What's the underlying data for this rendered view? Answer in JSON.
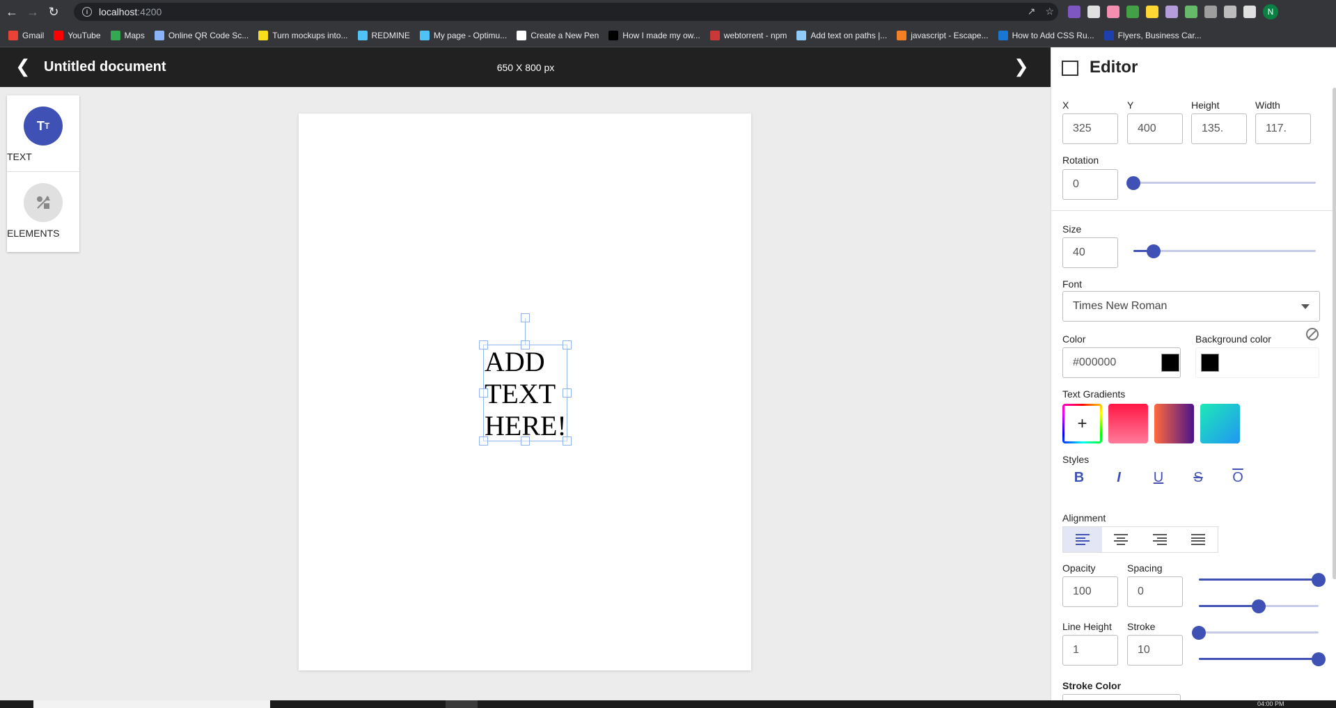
{
  "browser": {
    "url_host": "localhost",
    "url_port": ":4200",
    "bookmarks": [
      {
        "label": "Gmail",
        "color": "#ea4335"
      },
      {
        "label": "YouTube",
        "color": "#ff0000"
      },
      {
        "label": "Maps",
        "color": "#34a853"
      },
      {
        "label": "Online QR Code Sc...",
        "color": "#8ab4f8"
      },
      {
        "label": "Turn mockups into...",
        "color": "#f7df1e"
      },
      {
        "label": "REDMINE",
        "color": "#4fc3f7"
      },
      {
        "label": "My page - Optimu...",
        "color": "#4fc3f7"
      },
      {
        "label": "Create a New Pen",
        "color": "#ffffff"
      },
      {
        "label": "How I made my ow...",
        "color": "#000000"
      },
      {
        "label": "webtorrent - npm",
        "color": "#cb3837"
      },
      {
        "label": "Add text on paths |...",
        "color": "#90caf9"
      },
      {
        "label": "javascript - Escape...",
        "color": "#f48024"
      },
      {
        "label": "How to Add CSS Ru...",
        "color": "#1976d2"
      },
      {
        "label": "Flyers, Business Car...",
        "color": "#1e40af"
      }
    ],
    "profile_initial": "N"
  },
  "header": {
    "title": "Untitled document",
    "canvas_size": "650 X 800 px"
  },
  "tools": [
    {
      "label": "TEXT",
      "icon": "text-icon"
    },
    {
      "label": "ELEMENTS",
      "icon": "shapes-icon"
    }
  ],
  "canvas": {
    "text_lines": [
      "ADD",
      "TEXT",
      "HERE!"
    ]
  },
  "editor": {
    "title": "Editor",
    "x_label": "X",
    "x_value": "325",
    "y_label": "Y",
    "y_value": "400",
    "height_label": "Height",
    "height_value": "135.",
    "width_label": "Width",
    "width_value": "117.",
    "rotation_label": "Rotation",
    "rotation_value": "0",
    "size_label": "Size",
    "size_value": "40",
    "font_label": "Font",
    "font_value": "Times New Roman",
    "color_label": "Color",
    "color_value": "#000000",
    "bg_color_label": "Background color",
    "gradients_label": "Text Gradients",
    "gradients": [
      {
        "name": "add",
        "colors": []
      },
      {
        "name": "pink",
        "colors": [
          "#ff1744",
          "#ff7a9a"
        ]
      },
      {
        "name": "sunset",
        "colors": [
          "#ff6a3d",
          "#4a148c"
        ]
      },
      {
        "name": "ocean",
        "colors": [
          "#1de9b6",
          "#2196f3"
        ]
      }
    ],
    "styles_label": "Styles",
    "styles": [
      "B",
      "I",
      "U",
      "S",
      "O"
    ],
    "alignment_label": "Alignment",
    "opacity_label": "Opacity",
    "opacity_value": "100",
    "spacing_label": "Spacing",
    "spacing_value": "0",
    "line_height_label": "Line Height",
    "line_height_value": "1",
    "stroke_label": "Stroke",
    "stroke_value": "10",
    "stroke_color_label": "Stroke Color",
    "slider_levels": {
      "rotation": 0.0,
      "size": 0.11,
      "opacity": 1.0,
      "spacing": 0.5,
      "line_height": 0.0,
      "stroke": 1.0
    },
    "accent_color": "#3f51b5"
  },
  "taskbar": {
    "clock": "04:00 PM"
  }
}
